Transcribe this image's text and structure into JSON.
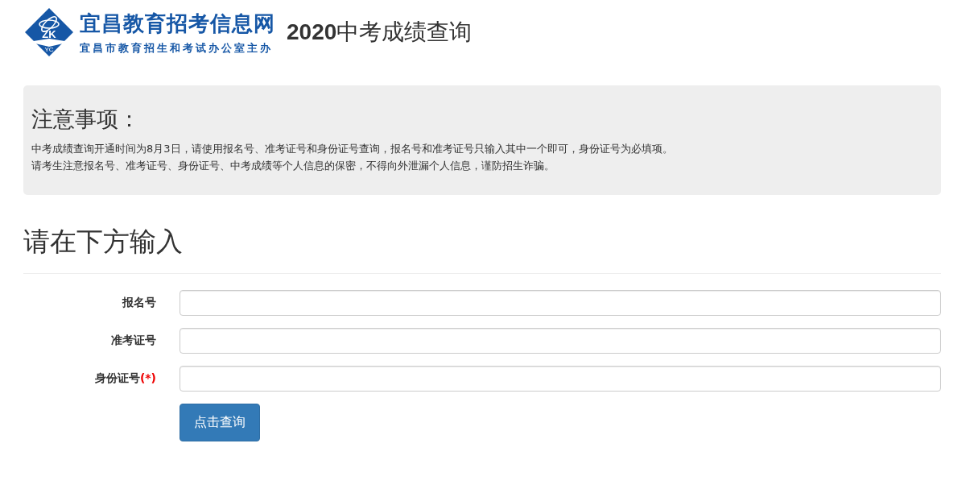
{
  "header": {
    "logo_letters": "ZK",
    "logo_sub": "YC",
    "site_name": "宜昌教育招考信息网",
    "site_tagline": "宜昌市教育招生和考试办公室主办",
    "page_title": "**2020**中考成绩查询"
  },
  "notice": {
    "heading": "注意事项：",
    "lines": [
      "中考成绩查询开通时间为8月3日，请使用报名号、准考证号和身份证号查询，报名号和准考证号只输入其中一个即可，身份证号为必填项。",
      "请考生注意报名号、准考证号、身份证号、中考成绩等个人信息的保密，不得向外泄漏个人信息，谨防招生诈骗。"
    ]
  },
  "form": {
    "heading": "请在下方输入",
    "fields": [
      {
        "label": "报名号"
      },
      {
        "label": "准考证号"
      },
      {
        "label": "身份证号",
        "required_mark": "(*)"
      }
    ],
    "submit": "点击查询"
  }
}
